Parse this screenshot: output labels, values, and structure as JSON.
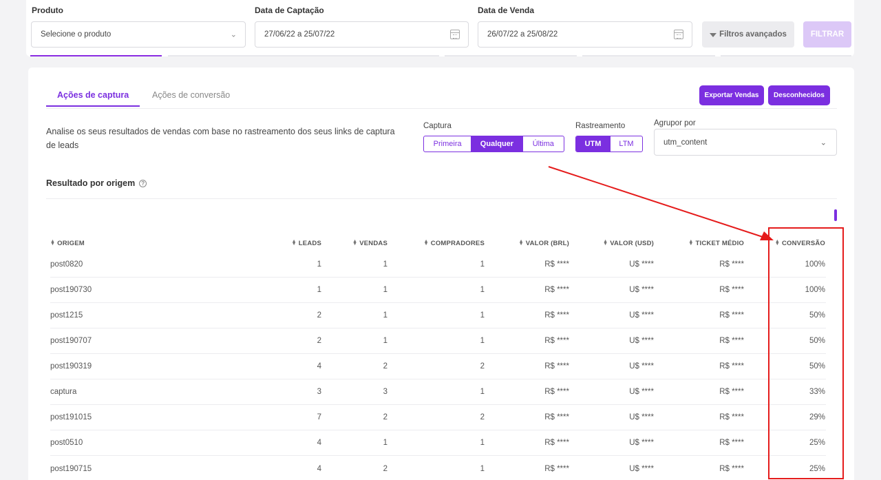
{
  "filters": {
    "produto": {
      "label": "Produto",
      "placeholder": "Selecione o produto"
    },
    "captacao": {
      "label": "Data de Captação",
      "value": "27/06/22 a 25/07/22"
    },
    "venda": {
      "label": "Data de Venda",
      "value": "26/07/22 a 25/08/22"
    },
    "advanced_label": "Filtros avançados",
    "filter_label": "FILTRAR"
  },
  "tabs": [
    {
      "label": "Ações de captura"
    },
    {
      "label": "Ações de conversão"
    }
  ],
  "actions": {
    "export_label": "Exportar Vendas",
    "unknown_label": "Desconhecidos"
  },
  "description": "Analise os seus resultados de vendas com base no rastreamento dos seus links de captura de leads",
  "captura": {
    "label": "Captura",
    "options": [
      "Primeira",
      "Qualquer",
      "Última"
    ],
    "selected": "Qualquer"
  },
  "rastreamento": {
    "label": "Rastreamento",
    "options": [
      "UTM",
      "LTM"
    ],
    "selected": "UTM"
  },
  "agrupor": {
    "label": "Agrupor por",
    "value": "utm_content"
  },
  "section_title": "Resultado por origem",
  "table": {
    "headers": [
      "ORIGEM",
      "LEADS",
      "VENDAS",
      "COMPRADORES",
      "VALOR (BRL)",
      "VALOR (USD)",
      "TICKET MÉDIO",
      "CONVERSÃO"
    ],
    "rows": [
      [
        "post0820",
        "1",
        "1",
        "1",
        "R$ ****",
        "U$ ****",
        "R$ ****",
        "100%"
      ],
      [
        "post190730",
        "1",
        "1",
        "1",
        "R$ ****",
        "U$ ****",
        "R$ ****",
        "100%"
      ],
      [
        "post1215",
        "2",
        "1",
        "1",
        "R$ ****",
        "U$ ****",
        "R$ ****",
        "50%"
      ],
      [
        "post190707",
        "2",
        "1",
        "1",
        "R$ ****",
        "U$ ****",
        "R$ ****",
        "50%"
      ],
      [
        "post190319",
        "4",
        "2",
        "2",
        "R$ ****",
        "U$ ****",
        "R$ ****",
        "50%"
      ],
      [
        "captura",
        "3",
        "3",
        "1",
        "R$ ****",
        "U$ ****",
        "R$ ****",
        "33%"
      ],
      [
        "post191015",
        "7",
        "2",
        "2",
        "R$ ****",
        "U$ ****",
        "R$ ****",
        "29%"
      ],
      [
        "post0510",
        "4",
        "1",
        "1",
        "R$ ****",
        "U$ ****",
        "R$ ****",
        "25%"
      ],
      [
        "post190715",
        "4",
        "2",
        "1",
        "R$ ****",
        "U$ ****",
        "R$ ****",
        "25%"
      ]
    ]
  },
  "colors": {
    "accent": "#7b2fe0",
    "annotation": "#e51b1b"
  }
}
